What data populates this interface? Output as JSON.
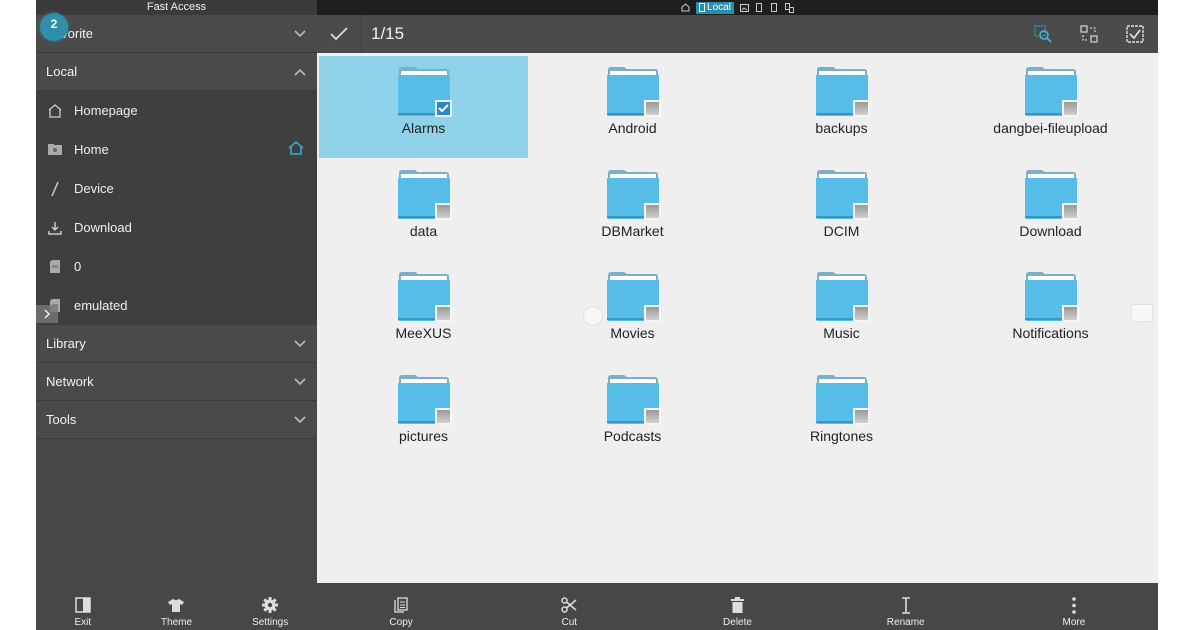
{
  "sidebar": {
    "title": "Fast Access",
    "badge": "2",
    "sections": [
      {
        "label": "Favorite",
        "expanded": false
      },
      {
        "label": "Local",
        "expanded": true
      },
      {
        "label": "Library",
        "expanded": false
      },
      {
        "label": "Network",
        "expanded": false
      },
      {
        "label": "Tools",
        "expanded": false
      }
    ],
    "local_items": [
      {
        "label": "Homepage",
        "icon": "homepage-icon"
      },
      {
        "label": "Home",
        "icon": "home-folder-icon",
        "is_home": true
      },
      {
        "label": "Device",
        "icon": "device-root-icon"
      },
      {
        "label": "Download",
        "icon": "download-icon"
      },
      {
        "label": "0",
        "icon": "sdcard-icon"
      },
      {
        "label": "emulated",
        "icon": "sdcard-icon"
      }
    ],
    "bottom": [
      {
        "label": "Exit",
        "icon": "exit-icon"
      },
      {
        "label": "Theme",
        "icon": "theme-shirt-icon"
      },
      {
        "label": "Settings",
        "icon": "gear-icon"
      }
    ]
  },
  "statusbar": {
    "active_label": "Local",
    "icons": [
      "home-icon",
      "local-icon",
      "image-icon",
      "phone-icon",
      "phone-icon",
      "network-device-icon"
    ]
  },
  "toolbar": {
    "selection_count": "1/15"
  },
  "files": [
    {
      "name": "Alarms",
      "selected": true
    },
    {
      "name": "Android",
      "selected": false
    },
    {
      "name": "backups",
      "selected": false
    },
    {
      "name": "dangbei-fileupload",
      "selected": false
    },
    {
      "name": "data",
      "selected": false
    },
    {
      "name": "DBMarket",
      "selected": false
    },
    {
      "name": "DCIM",
      "selected": false
    },
    {
      "name": "Download",
      "selected": false
    },
    {
      "name": "MeeXUS",
      "selected": false
    },
    {
      "name": "Movies",
      "selected": false
    },
    {
      "name": "Music",
      "selected": false
    },
    {
      "name": "Notifications",
      "selected": false
    },
    {
      "name": "pictures",
      "selected": false
    },
    {
      "name": "Podcasts",
      "selected": false
    },
    {
      "name": "Ringtones",
      "selected": false
    }
  ],
  "actions": [
    {
      "label": "Copy",
      "icon": "copy-icon"
    },
    {
      "label": "Cut",
      "icon": "cut-icon"
    },
    {
      "label": "Delete",
      "icon": "delete-icon"
    },
    {
      "label": "Rename",
      "icon": "rename-icon"
    },
    {
      "label": "More",
      "icon": "more-icon"
    }
  ],
  "colors": {
    "accent": "#2a8fae",
    "selection": "#8fd2ea",
    "folder": "#56bde9"
  }
}
